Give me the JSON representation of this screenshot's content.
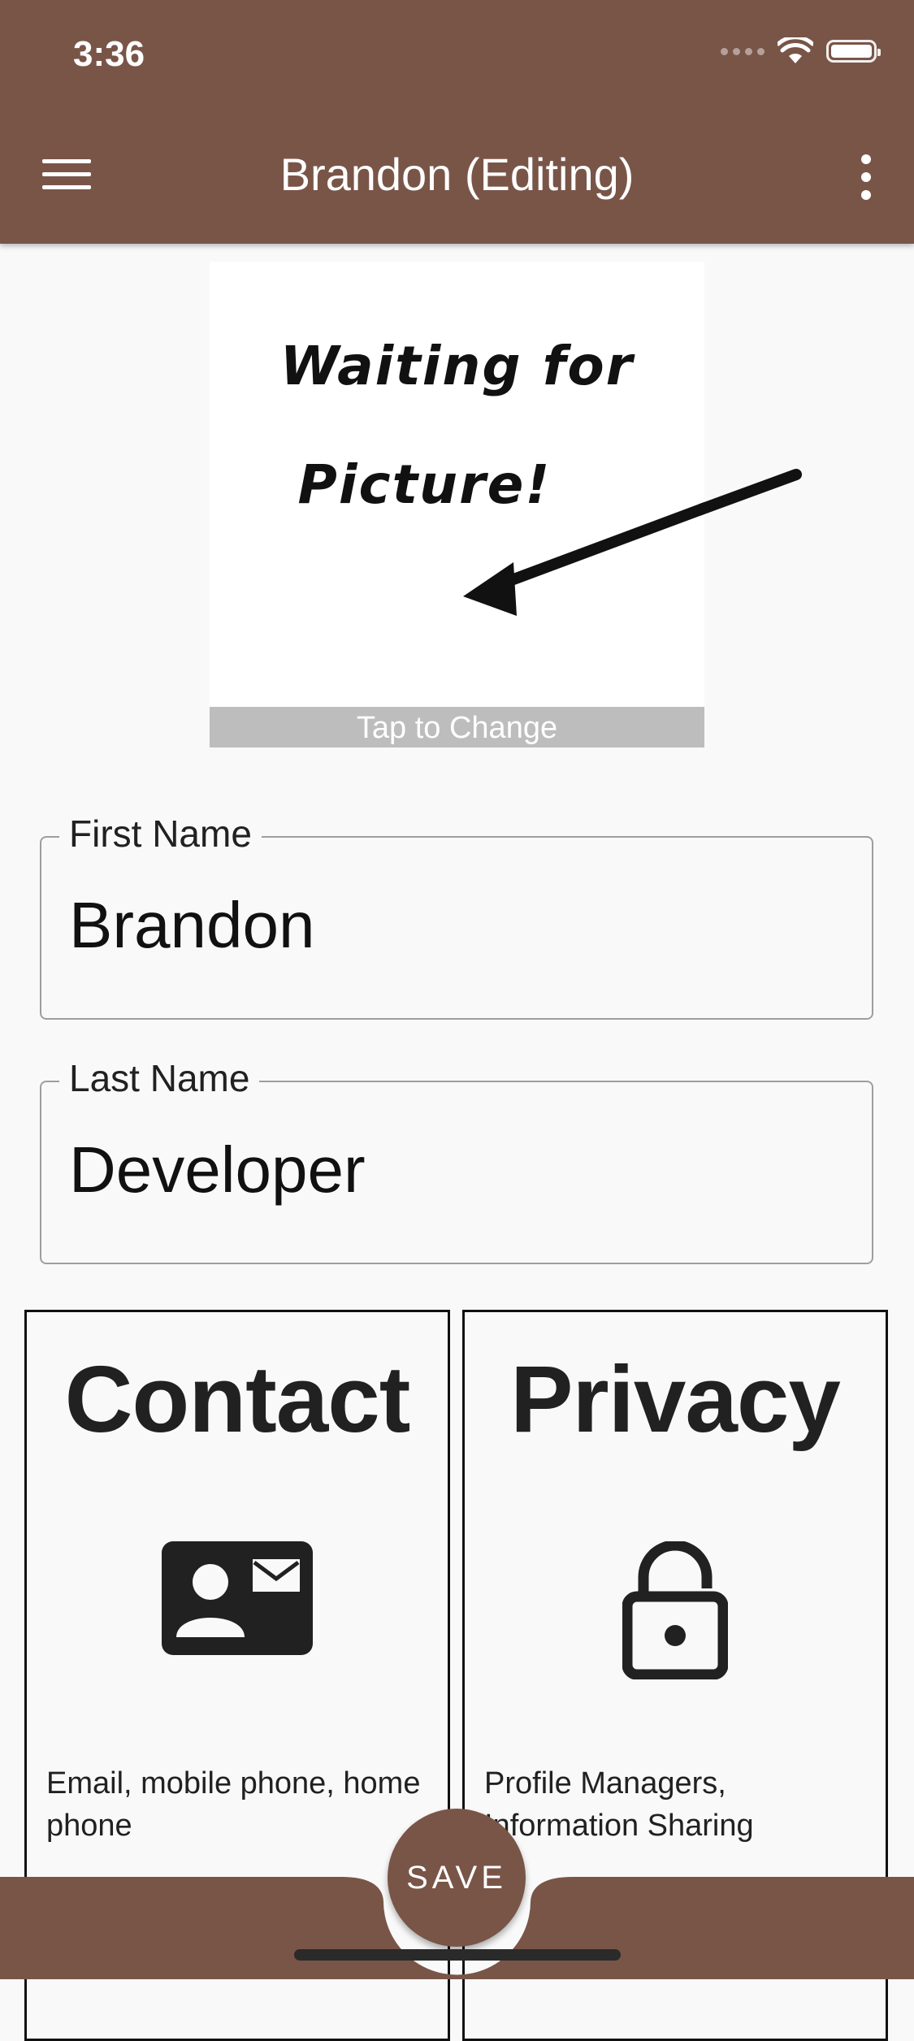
{
  "status_bar": {
    "time": "3:36"
  },
  "app_bar": {
    "title": "Brandon (Editing)"
  },
  "picture": {
    "placeholder_line1": "Waiting for",
    "placeholder_line2": "Picture!",
    "tap_label": "Tap to Change"
  },
  "form": {
    "first_name": {
      "label": "First Name",
      "value": "Brandon"
    },
    "last_name": {
      "label": "Last Name",
      "value": "Developer"
    }
  },
  "cards": [
    {
      "title": "Contact",
      "icon": "contact-card-icon",
      "description": "Email, mobile phone, home phone"
    },
    {
      "title": "Privacy",
      "icon": "lock-open-icon",
      "description": "Profile Managers, Information Sharing"
    }
  ],
  "bottom": {
    "save_label": "SAVE"
  },
  "colors": {
    "primary": "#795548",
    "background": "#f9f9f9"
  }
}
